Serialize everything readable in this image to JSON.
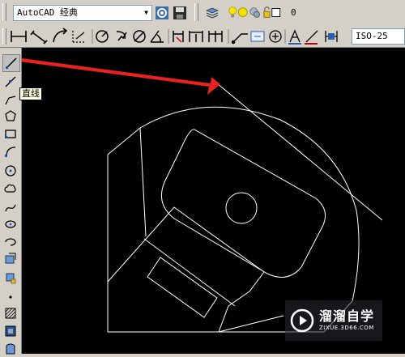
{
  "toolbar_top": {
    "workspace_value": "AutoCAD 经典",
    "layer_value": "0"
  },
  "toolbar_dim": {
    "dimstyle_value": "ISO-25"
  },
  "tooltip": "直线",
  "watermark": {
    "brand": "溜溜自学",
    "url": "ZIXUE.3D66.COM"
  },
  "colors": {
    "canvas": "#000000",
    "arrow": "#e8231f",
    "drawing": "#ffffff"
  },
  "icons": {
    "draw_toolbar": [
      "line",
      "construction-line",
      "polyline",
      "polygon",
      "rectangle",
      "arc",
      "circle",
      "revision-cloud",
      "spline",
      "ellipse",
      "ellipse-arc",
      "insert-block",
      "make-block",
      "point",
      "hatch",
      "gradient",
      "region"
    ]
  }
}
